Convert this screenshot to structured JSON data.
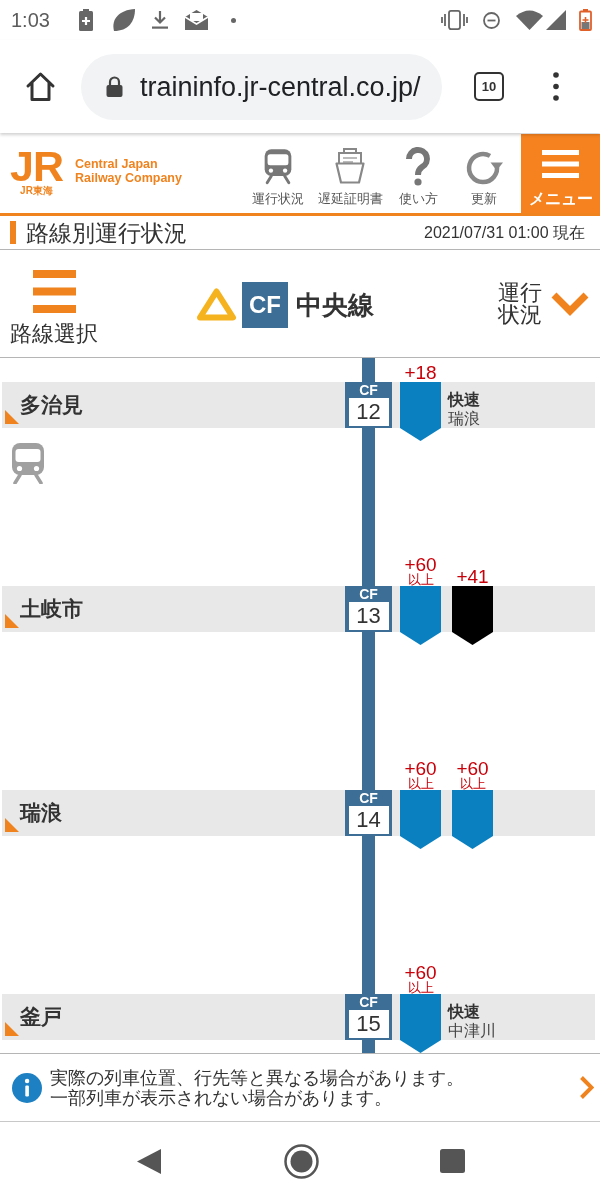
{
  "status_bar": {
    "time": "1:03"
  },
  "browser": {
    "url": "traininfo.jr-central.co.jp/",
    "tab_count": "10"
  },
  "header": {
    "logo": {
      "mark": "JR",
      "sub": "JR東海",
      "company": [
        "Central Japan",
        "Railway Company"
      ]
    },
    "nav": [
      {
        "kind": "status",
        "label": "運行状況"
      },
      {
        "kind": "certificate",
        "label": "遅延証明書"
      },
      {
        "kind": "help",
        "label": "使い方"
      },
      {
        "kind": "refresh",
        "label": "更新"
      }
    ],
    "menu": {
      "label": "メニュー"
    }
  },
  "page_title": {
    "title": "路線別運行状況",
    "timestamp": "2021/07/31 01:00 現在"
  },
  "line_bar": {
    "select_label": "路線選択",
    "line": {
      "delayed": true,
      "code": "CF",
      "name": "中央線"
    },
    "view": {
      "label": "運行状況"
    }
  },
  "stations": [
    {
      "name": "多治見",
      "code": "CF",
      "number": "12",
      "train_icon": true,
      "trains": [
        {
          "delay": "+18",
          "color": "#0a80c0",
          "type": "快速",
          "destination": "瑞浪"
        }
      ]
    },
    {
      "name": "土岐市",
      "code": "CF",
      "number": "13",
      "train_icon": false,
      "trains": [
        {
          "delay": "+60",
          "delay_note": "以上",
          "color": "#0a80c0"
        },
        {
          "delay": "+41",
          "color": "#000000"
        }
      ]
    },
    {
      "name": "瑞浪",
      "code": "CF",
      "number": "14",
      "train_icon": false,
      "trains": [
        {
          "delay": "+60",
          "delay_note": "以上",
          "color": "#0a80c0"
        },
        {
          "delay": "+60",
          "delay_note": "以上",
          "color": "#0a80c0"
        }
      ]
    },
    {
      "name": "釜戸",
      "code": "CF",
      "number": "15",
      "train_icon": false,
      "trains": [
        {
          "delay": "+60",
          "delay_note": "以上",
          "color": "#0a80c0",
          "type": "快速",
          "destination": "中津川"
        }
      ]
    }
  ],
  "notice": {
    "lines": [
      "実際の列車位置、行先等と異なる場合があります。",
      "一部列車が表示されない場合があります。"
    ]
  }
}
